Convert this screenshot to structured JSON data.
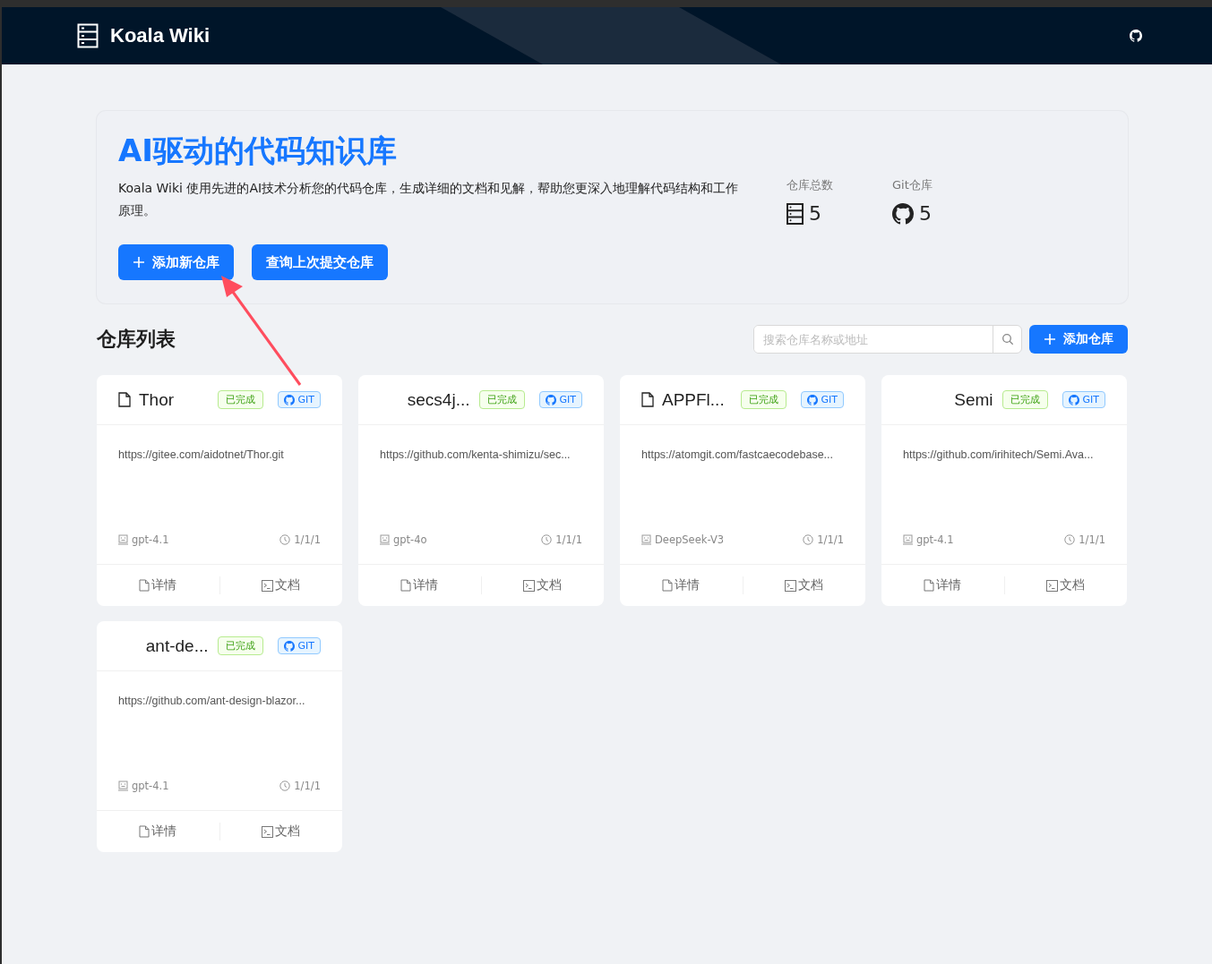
{
  "header": {
    "title": "Koala Wiki"
  },
  "hero": {
    "title": "AI驱动的代码知识库",
    "description": "Koala Wiki 使用先进的AI技术分析您的代码仓库，生成详细的文档和见解，帮助您更深入地理解代码结构和工作原理。",
    "buttons": [
      {
        "label": "添加新仓库",
        "kind": "add"
      },
      {
        "label": "查询上次提交仓库",
        "kind": "plain"
      }
    ],
    "stats": [
      {
        "label": "仓库总数",
        "value": "5",
        "kind": "server"
      },
      {
        "label": "Git仓库",
        "value": "5",
        "kind": "github"
      }
    ]
  },
  "list": {
    "title": "仓库列表",
    "search": {
      "placeholder": "搜索仓库名称或地址"
    },
    "add_button": "添加仓库",
    "repos": [
      {
        "name": "Thor",
        "file_icon": true,
        "status": "已完成",
        "type": "GIT",
        "url": "https://gitee.com/aidotnet/Thor.git",
        "model": "gpt-4.1",
        "date": "1/1/1",
        "actions": [
          "详情",
          "文档"
        ]
      },
      {
        "name": "secs4j...",
        "file_icon": false,
        "status": "已完成",
        "type": "GIT",
        "url": "https://github.com/kenta-shimizu/sec...",
        "model": "gpt-4o",
        "date": "1/1/1",
        "actions": [
          "详情",
          "文档"
        ]
      },
      {
        "name": "APPFl...",
        "file_icon": true,
        "status": "已完成",
        "type": "GIT",
        "url": "https://atomgit.com/fastcaecodebase...",
        "model": "DeepSeek-V3",
        "date": "1/1/1",
        "actions": [
          "详情",
          "文档"
        ]
      },
      {
        "name": "Semi",
        "file_icon": false,
        "status": "已完成",
        "type": "GIT",
        "url": "https://github.com/irihitech/Semi.Ava...",
        "model": "gpt-4.1",
        "date": "1/1/1",
        "actions": [
          "详情",
          "文档"
        ]
      },
      {
        "name": "ant-de...",
        "file_icon": false,
        "status": "已完成",
        "type": "GIT",
        "url": "https://github.com/ant-design-blazor...",
        "model": "gpt-4.1",
        "date": "1/1/1",
        "actions": [
          "详情",
          "文档"
        ]
      }
    ]
  }
}
